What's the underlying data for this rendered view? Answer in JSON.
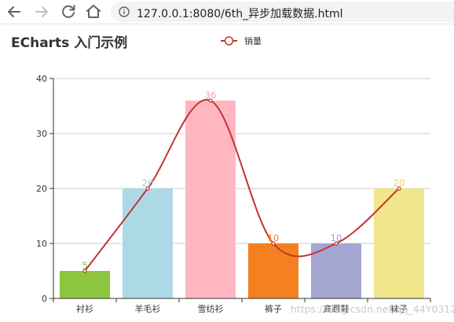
{
  "browser": {
    "address_bar_text": "127.0.0.1:8080/6th_异步加载数据.html",
    "icons": [
      "back-arrow-icon",
      "forward-arrow-icon",
      "reload-icon",
      "home-icon",
      "info-icon"
    ]
  },
  "watermark": "https://blog.csdn.net/qq_44Y0312",
  "chart_data": {
    "type": "bar",
    "title": "ECharts 入门示例",
    "categories": [
      "衬衫",
      "羊毛衫",
      "雪纺衫",
      "裤子",
      "高跟鞋",
      "袜子"
    ],
    "series": [
      {
        "name": "销量",
        "type": "bar",
        "values": [
          5,
          20,
          36,
          10,
          10,
          20
        ],
        "colors": [
          "#8cc63e",
          "#add8e6",
          "#ffb6c1",
          "#f5801f",
          "#a5a5d2",
          "#f0e68c"
        ],
        "label_colors": [
          "#8cc63e",
          "#9ec7e0",
          "#f4a6b6",
          "#f5801f",
          "#9e9ecc",
          "#e5d44a"
        ],
        "show_labels": true
      },
      {
        "name": "销量",
        "type": "line",
        "smooth": true,
        "values": [
          5,
          20,
          36,
          10,
          10,
          20
        ],
        "color": "#c23531"
      }
    ],
    "legend": {
      "entries": [
        "销量"
      ],
      "placement": "top-center"
    },
    "ylim": [
      0,
      40
    ],
    "yticks": [
      0,
      10,
      20,
      30,
      40
    ],
    "grid": true
  }
}
